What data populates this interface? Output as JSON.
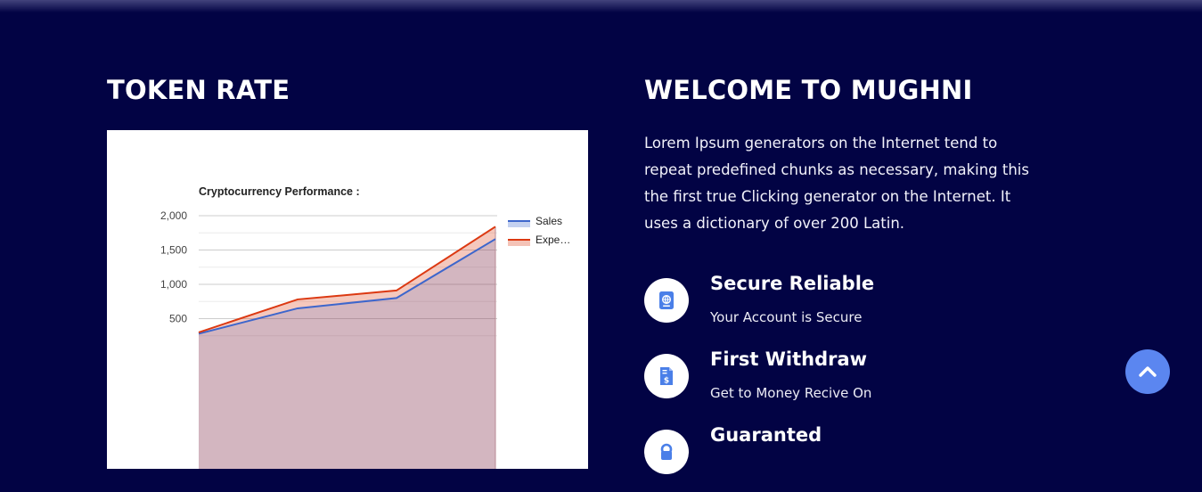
{
  "token_rate": {
    "title": "TOKEN RATE"
  },
  "welcome": {
    "title": "WELCOME TO MUGHNI",
    "intro": "Lorem Ipsum generators on the Internet tend to repeat predefined chunks as necessary, making this the first true Clicking generator on the Internet. It uses a dictionary of over 200 Latin."
  },
  "features": [
    {
      "title": "Secure Reliable",
      "subtitle": "Your Account is Secure",
      "icon": "passport-icon"
    },
    {
      "title": "First Withdraw",
      "subtitle": "Get to Money Recive On",
      "icon": "invoice-dollar-icon"
    },
    {
      "title": "Guaranted",
      "subtitle": "",
      "icon": "lock-icon"
    }
  ],
  "scroll_top": {
    "icon": "chevron-up-icon"
  },
  "colors": {
    "background": "#020344",
    "sales": "#3d66cc",
    "expenses": "#dc3912",
    "scroll_button": "#5b86f0"
  },
  "chart_data": {
    "type": "area",
    "title": "Cryptocurrency Performance :",
    "ylim": [
      0,
      2000
    ],
    "y_ticks": [
      "2,000",
      "1,500",
      "1,000",
      "500"
    ],
    "series": [
      {
        "name": "Sales",
        "values": [
          280,
          650,
          800,
          1660
        ]
      },
      {
        "name": "Expe…",
        "values": [
          300,
          780,
          910,
          1840
        ]
      }
    ],
    "legend_position": "right",
    "grid": true
  }
}
